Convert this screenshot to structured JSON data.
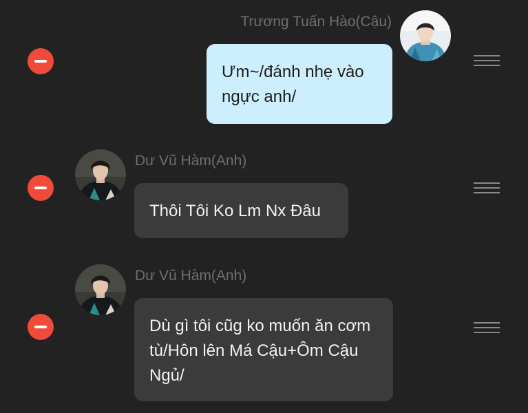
{
  "theme": {
    "background": "#222222",
    "outgoing_bubble": "#cdeefd",
    "incoming_bubble": "#3b3b3b",
    "remove_button": "#f04a3b",
    "name_color": "#6f6f6f"
  },
  "messages": [
    {
      "sender": "Trương Tuấn Hào(Cậu)",
      "text": "Ưm~/đánh nhẹ vào ngực anh/",
      "side": "right",
      "avatar_icon": "avatar-photo-icon"
    },
    {
      "sender": "Dư Vũ Hàm(Anh)",
      "text": "Thôi Tôi Ko Lm Nx Đâu",
      "side": "left",
      "avatar_icon": "avatar-photo-icon"
    },
    {
      "sender": "Dư Vũ Hàm(Anh)",
      "text": "Dù gì tôi cũg ko muốn ăn cơm tù/Hôn lên Má Cậu+Ôm Cậu Ngủ/",
      "side": "left",
      "avatar_icon": "avatar-photo-icon"
    }
  ],
  "controls": {
    "remove_icon": "minus-circle-icon",
    "drag_icon": "drag-handle-icon"
  }
}
